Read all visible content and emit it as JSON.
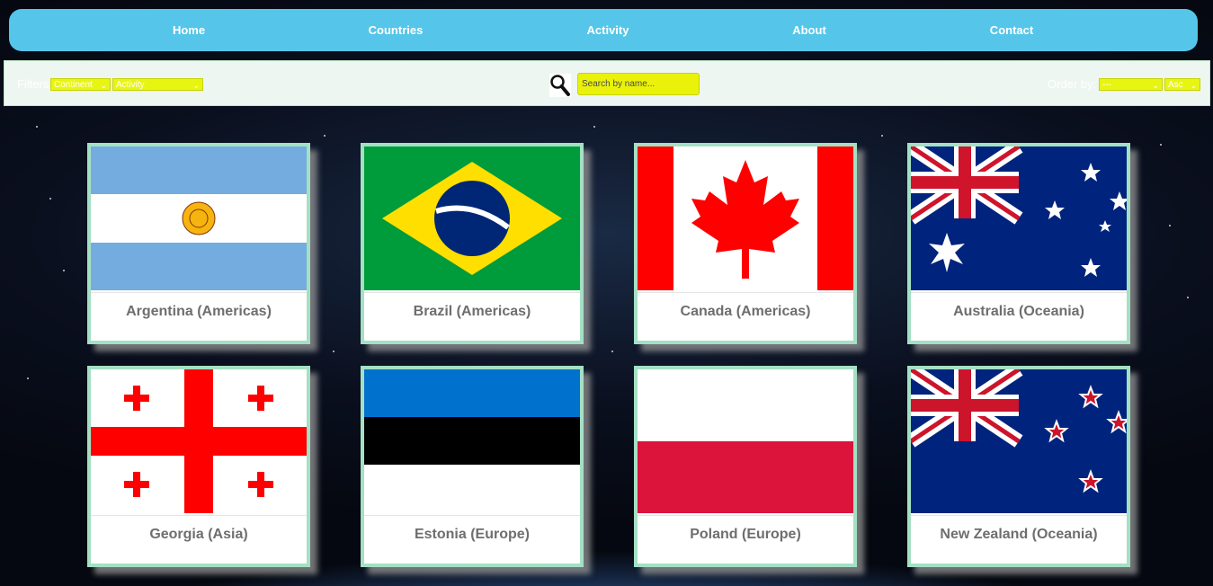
{
  "nav": {
    "items": [
      {
        "label": "Home"
      },
      {
        "label": "Countries"
      },
      {
        "label": "Activity"
      },
      {
        "label": "About"
      },
      {
        "label": "Contact"
      }
    ]
  },
  "filters": {
    "label": "Filters:",
    "continent_value": "Continent",
    "activity_value": "Activity",
    "search_placeholder": "Search by name...",
    "order_label": "Order by:",
    "order_value": "---",
    "direction_value": "Asc"
  },
  "countries": [
    {
      "title": "Argentina (Americas)",
      "flag": "argentina-flag"
    },
    {
      "title": "Brazil (Americas)",
      "flag": "brazil-flag"
    },
    {
      "title": "Canada (Americas)",
      "flag": "canada-flag"
    },
    {
      "title": "Australia (Oceania)",
      "flag": "australia-flag"
    },
    {
      "title": "Georgia (Asia)",
      "flag": "georgia-flag"
    },
    {
      "title": "Estonia (Europe)",
      "flag": "estonia-flag"
    },
    {
      "title": "Poland (Europe)",
      "flag": "poland-flag"
    },
    {
      "title": "New Zealand (Oceania)",
      "flag": "new-zealand-flag"
    }
  ],
  "colors": {
    "nav_bg": "#55c6e9",
    "select_bg": "#e8f510",
    "card_border": "#a4e0c4",
    "card_title": "#6e6e6e"
  }
}
